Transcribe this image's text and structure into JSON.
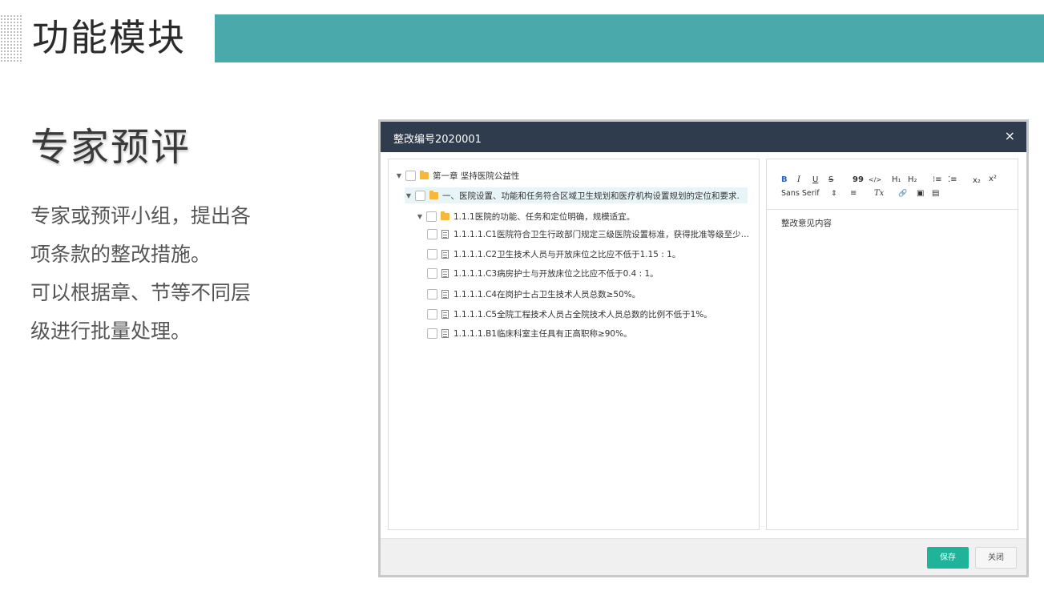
{
  "header": {
    "title": "功能模块",
    "accent_color": "#4aa9ab"
  },
  "section": {
    "title": "专家预评",
    "description_lines": [
      "专家或预评小组，提出各",
      "项条款的整改措施。",
      "可以根据章、节等不同层",
      "级进行批量处理。"
    ]
  },
  "dialog": {
    "title": "整改编号2020001",
    "close_icon": "×",
    "tree": [
      {
        "label": "第一章 坚持医院公益性",
        "type": "folder"
      },
      {
        "label": "一、医院设置、功能和任务符合区域卫生规划和医疗机构设置规划的定位和要求.",
        "type": "folder"
      },
      {
        "label": "1.1.1医院的功能、任务和定位明确，规模适宜。",
        "type": "folder"
      },
      {
        "label": "1.1.1.1.C1医院符合卫生行政部门规定三级医院设置标准，获得批准等级至少正...",
        "type": "doc"
      },
      {
        "label": "1.1.1.1.C2卫生技术人员与开放床位之比应不低于1.15 : 1。",
        "type": "doc"
      },
      {
        "label": "1.1.1.1.C3病房护士与开放床位之比应不低于0.4 : 1。",
        "type": "doc"
      },
      {
        "label": "1.1.1.1.C4在岗护士占卫生技术人员总数≥50%。",
        "type": "doc"
      },
      {
        "label": "1.1.1.1.C5全院工程技术人员占全院技术人员总数的比例不低于1%。",
        "type": "doc"
      },
      {
        "label": "1.1.1.1.B1临床科室主任具有正高职称≥90%。",
        "type": "doc"
      }
    ],
    "editor": {
      "toolbar": {
        "bold": "B",
        "italic": "I",
        "underline": "U",
        "strike": "S",
        "quote": "99",
        "code": "</>",
        "h1": "H₁",
        "h2": "H₂",
        "ordered_list": "⁝≡",
        "bullet_list": "⁚≡",
        "subscript": "x₂",
        "superscript": "x²",
        "font": "Sans Serif",
        "font_arrow": "⇕",
        "align": "≡",
        "clear_format": "Tx",
        "link": "🔗",
        "image": "▣",
        "video": "▤"
      },
      "content": "整改意见内容"
    },
    "buttons": {
      "save": "保存",
      "close": "关闭"
    },
    "save_color": "#1fb399"
  }
}
